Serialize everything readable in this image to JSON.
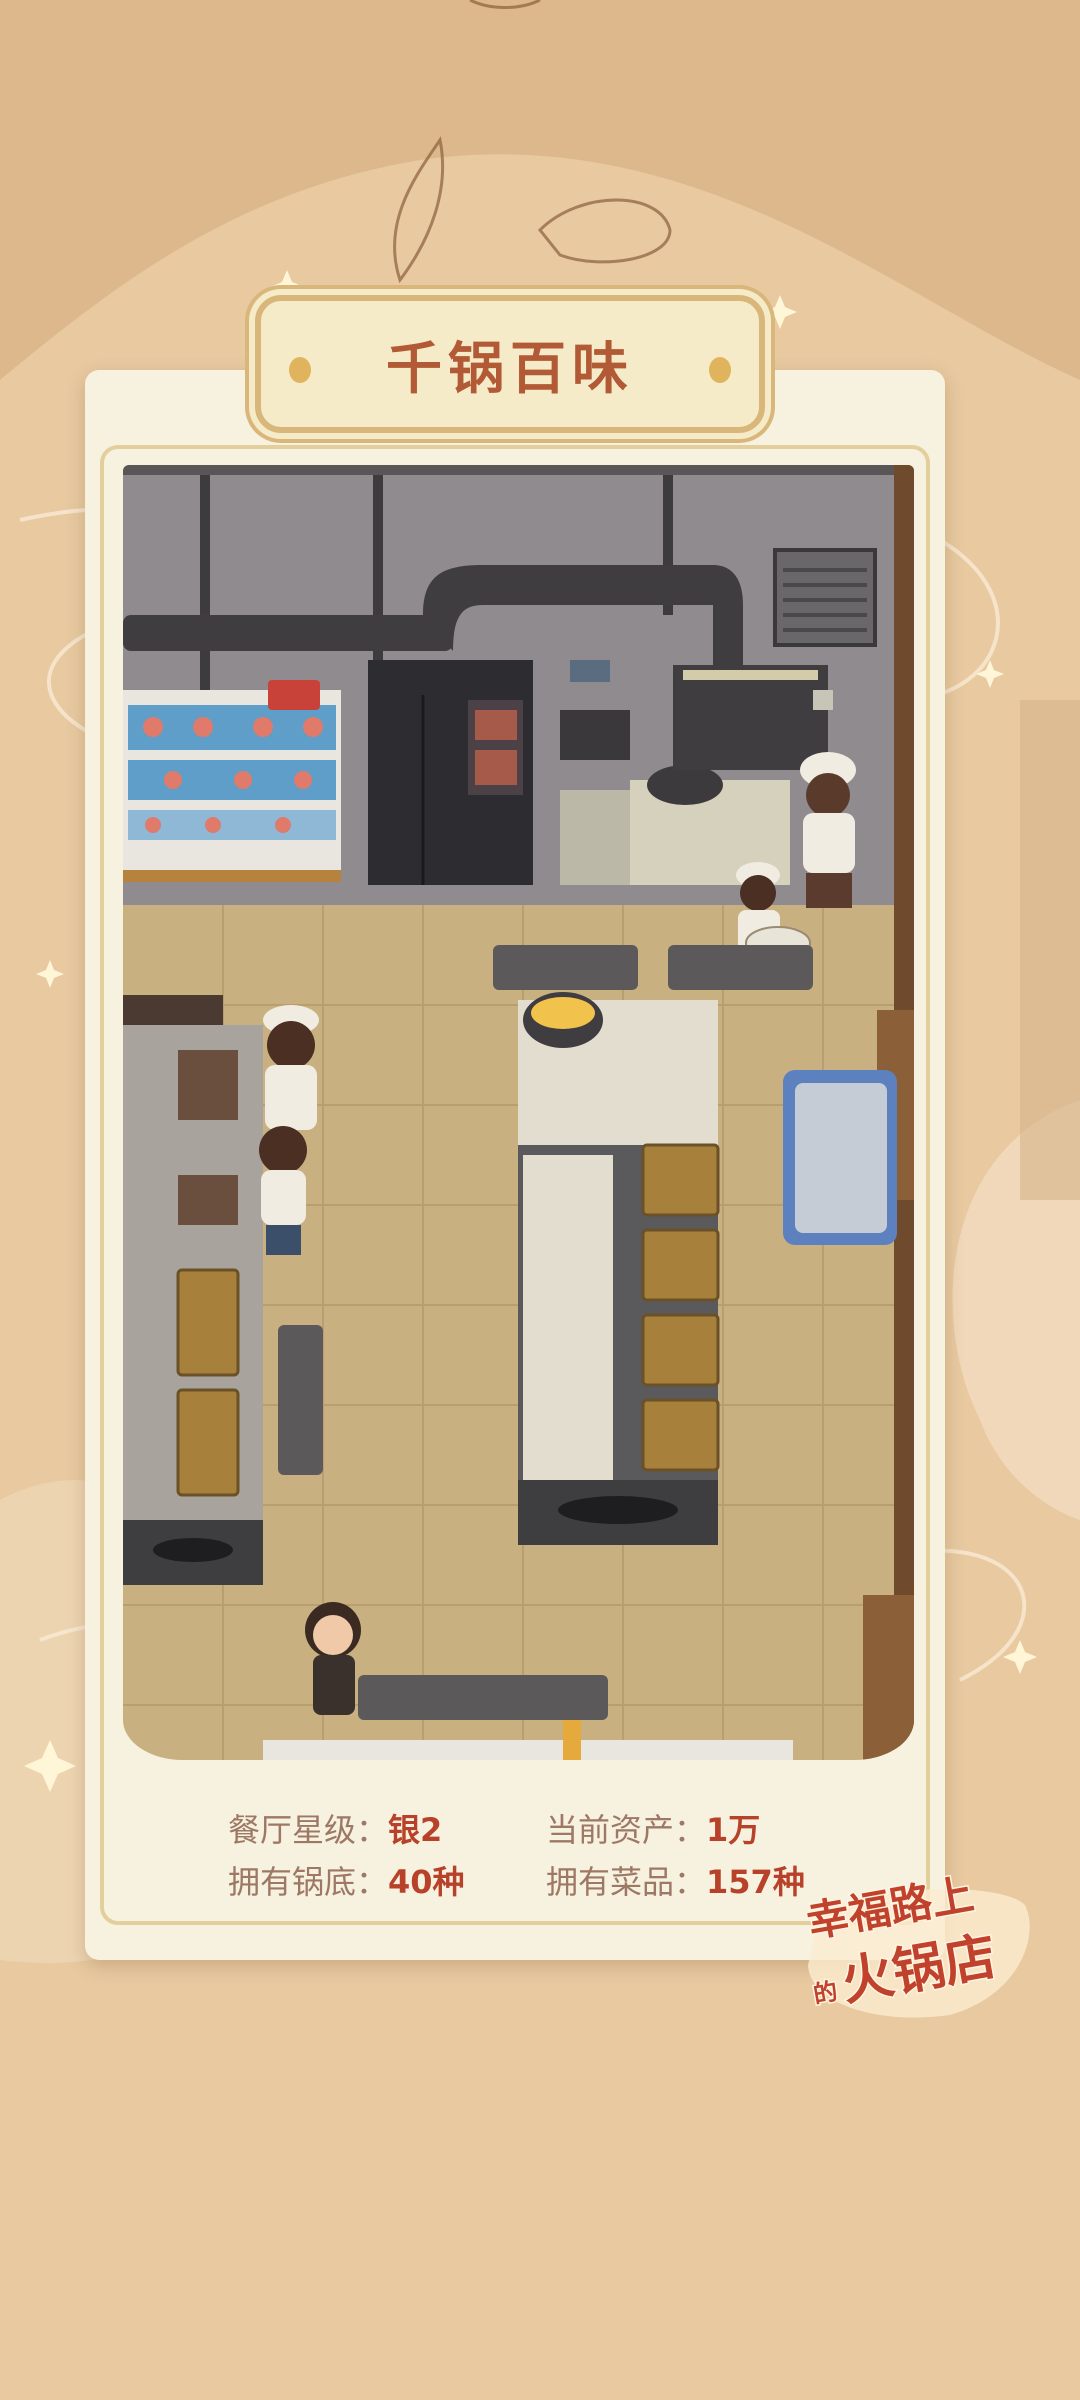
{
  "title": "千锅百味",
  "stats": {
    "row1": [
      {
        "label": "餐厅星级：",
        "value": "银2"
      },
      {
        "label": "当前资产：",
        "value": "1万"
      }
    ],
    "row2": [
      {
        "label": "拥有锅底：",
        "value": "40种"
      },
      {
        "label": "拥有菜品：",
        "value": "157种"
      }
    ]
  },
  "logo": {
    "line1": "幸福路上",
    "line2_small": "的",
    "line2": "火锅店"
  },
  "colors": {
    "background": "#e8c9a0",
    "card": "#f7f1df",
    "title_text": "#b15a35",
    "stat_value": "#b8412a",
    "stat_label": "#9d7865",
    "floor": "#c9b080"
  }
}
